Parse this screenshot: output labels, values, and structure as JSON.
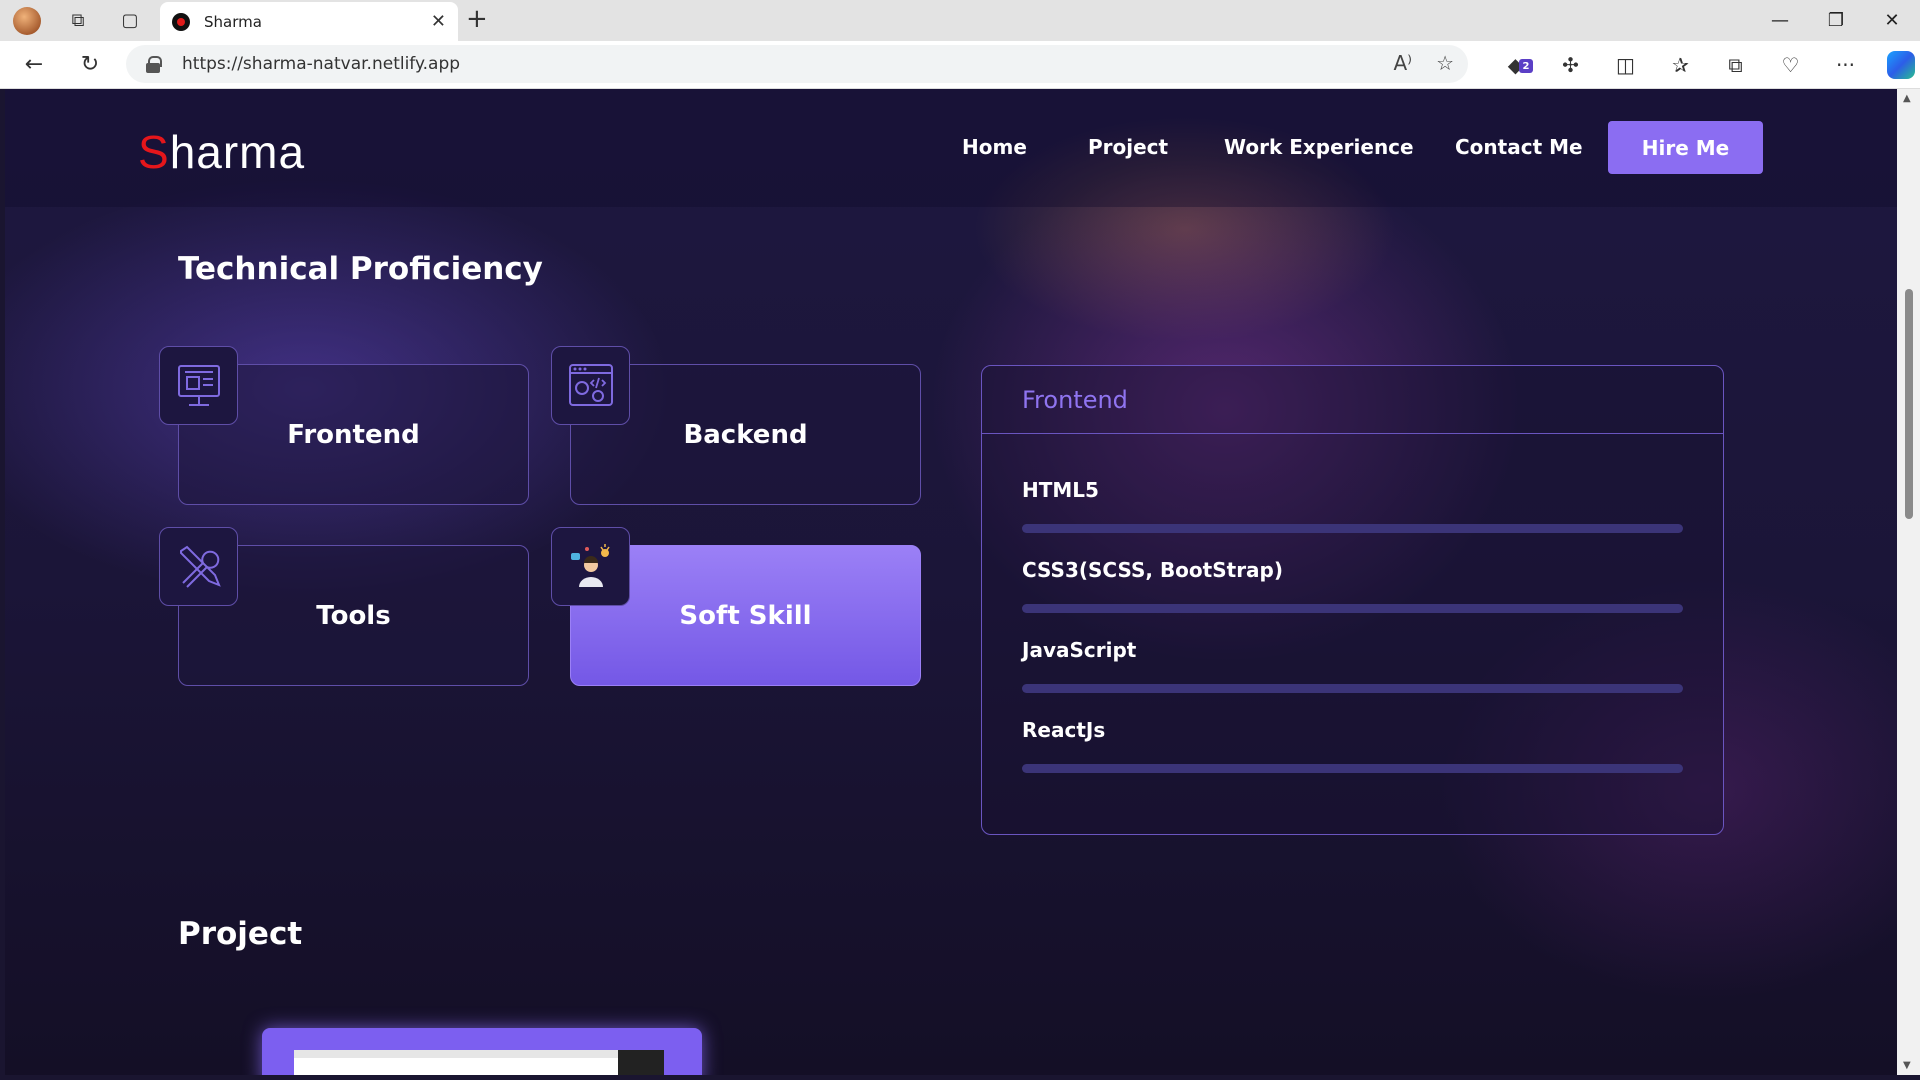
{
  "browser": {
    "tab_title": "Sharma",
    "url": "https://sharma-natvar.netlify.app",
    "extension_badge": "2"
  },
  "site": {
    "logo_first": "S",
    "logo_rest": "harma",
    "nav": [
      "Home",
      "Project",
      "Work Experience",
      "Contact Me"
    ],
    "hire_label": "Hire Me"
  },
  "proficiency": {
    "title": "Technical Proficiency",
    "categories": [
      {
        "label": "Frontend",
        "icon": "monitor-icon",
        "active": false
      },
      {
        "label": "Backend",
        "icon": "code-gears-icon",
        "active": false
      },
      {
        "label": "Tools",
        "icon": "wrench-screwdriver-icon",
        "active": false
      },
      {
        "label": "Soft Skill",
        "icon": "person-idea-icon",
        "active": true
      }
    ],
    "panel": {
      "title": "Frontend",
      "skills": [
        "HTML5",
        "CSS3(SCSS, BootStrap)",
        "JavaScript",
        "ReactJs"
      ]
    }
  },
  "project": {
    "title": "Project"
  },
  "colors": {
    "accent": "#8b6df2",
    "logo_red": "#e5161b",
    "border": "#5f4ea8"
  }
}
